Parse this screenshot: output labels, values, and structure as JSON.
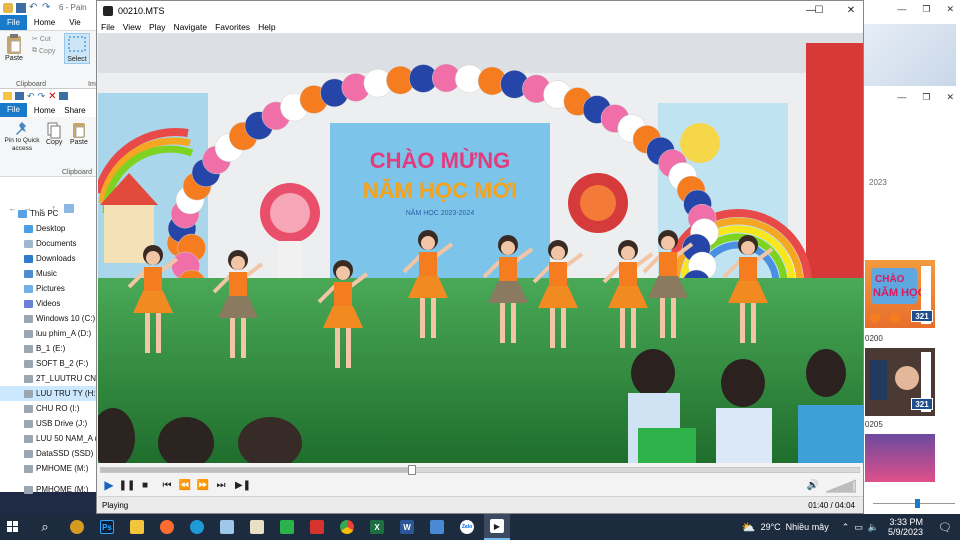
{
  "explorer_back": {
    "tabs": [
      "File",
      "Home",
      "Vie"
    ],
    "title_fragment": "6 - Pain",
    "ribbon": {
      "paste": "Paste",
      "cut": "Cut",
      "copy": "Copy",
      "select": "Select",
      "group_label": "Clipboard",
      "group_label2": "Ima"
    }
  },
  "explorer_front": {
    "tabs": [
      "File",
      "Home",
      "Share"
    ],
    "ribbon": {
      "pin": "Pin to Quick access",
      "copy": "Copy",
      "paste": "Paste",
      "group_label": "Clipboard"
    },
    "nav": [
      {
        "label": "This PC",
        "icon": "pc-icon",
        "selected": false
      },
      {
        "label": "Desktop",
        "icon": "desktop-icon",
        "selected": false
      },
      {
        "label": "Documents",
        "icon": "documents-icon",
        "selected": false
      },
      {
        "label": "Downloads",
        "icon": "downloads-icon",
        "selected": false
      },
      {
        "label": "Music",
        "icon": "music-icon",
        "selected": false
      },
      {
        "label": "Pictures",
        "icon": "pictures-icon",
        "selected": false
      },
      {
        "label": "Videos",
        "icon": "videos-icon",
        "selected": false
      },
      {
        "label": "Windows 10 (C:)",
        "icon": "drive-icon",
        "selected": false
      },
      {
        "label": "luu phim_A (D:)",
        "icon": "drive-icon",
        "selected": false
      },
      {
        "label": "B_1 (E:)",
        "icon": "drive-icon",
        "selected": false
      },
      {
        "label": "SOFT B_2 (F:)",
        "icon": "drive-icon",
        "selected": false
      },
      {
        "label": "2T_LUUTRU CN (G:)",
        "icon": "drive-icon",
        "selected": false
      },
      {
        "label": "LUU TRU TY (H:)",
        "icon": "drive-icon",
        "selected": true
      },
      {
        "label": "CHU RO (I:)",
        "icon": "drive-icon",
        "selected": false
      },
      {
        "label": "USB Drive (J:)",
        "icon": "drive-icon",
        "selected": false
      },
      {
        "label": "LUU 50 NAM_A (K:)",
        "icon": "drive-icon",
        "selected": false
      },
      {
        "label": "DataSSD (SSD) (L:)",
        "icon": "drive-icon",
        "selected": false
      },
      {
        "label": "PMHOME (M:)",
        "icon": "drive-icon",
        "selected": false
      },
      {
        "label": "PMHOME (M:)",
        "icon": "drive-icon",
        "selected": false
      }
    ]
  },
  "photos": {
    "year_label": "2023",
    "thumb1_caption": "0200",
    "thumb2_caption": "0205",
    "badge": "321"
  },
  "player": {
    "window_title": "00210.MTS",
    "menu": [
      "File",
      "View",
      "Play",
      "Navigate",
      "Favorites",
      "Help"
    ],
    "status_text": "Playing",
    "time_current": "01:40",
    "time_separator": "/",
    "time_total": "04:04",
    "progress_fraction": 0.41,
    "volume_fraction": 0.9,
    "banner": {
      "line1": "CHÀO MỪNG",
      "line2": "NĂM HỌC MỚI",
      "line3": "NĂM HỌC 2023-2024"
    },
    "controls": [
      "play-icon",
      "pause-icon",
      "stop-icon",
      "skip-back-icon",
      "rewind-icon",
      "forward-icon",
      "skip-forward-icon",
      "frame-step-icon",
      "volume-icon"
    ]
  },
  "taskbar": {
    "weather_temp": "29°C",
    "weather_text": "Nhiều mây",
    "time": "3:33 PM",
    "date": "5/9/2023",
    "apps": [
      "start-icon",
      "search-icon",
      "chrome-canary-icon",
      "photoshop-icon",
      "file-explorer-icon",
      "firefox-icon",
      "edge-icon",
      "paint-icon",
      "calculator-icon",
      "phone-icon",
      "vpn-icon",
      "chrome-icon",
      "excel-icon",
      "word-icon",
      "photos-icon",
      "zalo-icon",
      "media-player-icon"
    ],
    "ps_label": "Ps",
    "excel_label": "X",
    "word_label": "W",
    "zalo_label": "Zalo"
  },
  "colors": {
    "accent_blue": "#1979ca",
    "taskbar": "#1d2b3f",
    "dress_orange": "#f57c1f",
    "turf_green": "#2f8f3e"
  }
}
